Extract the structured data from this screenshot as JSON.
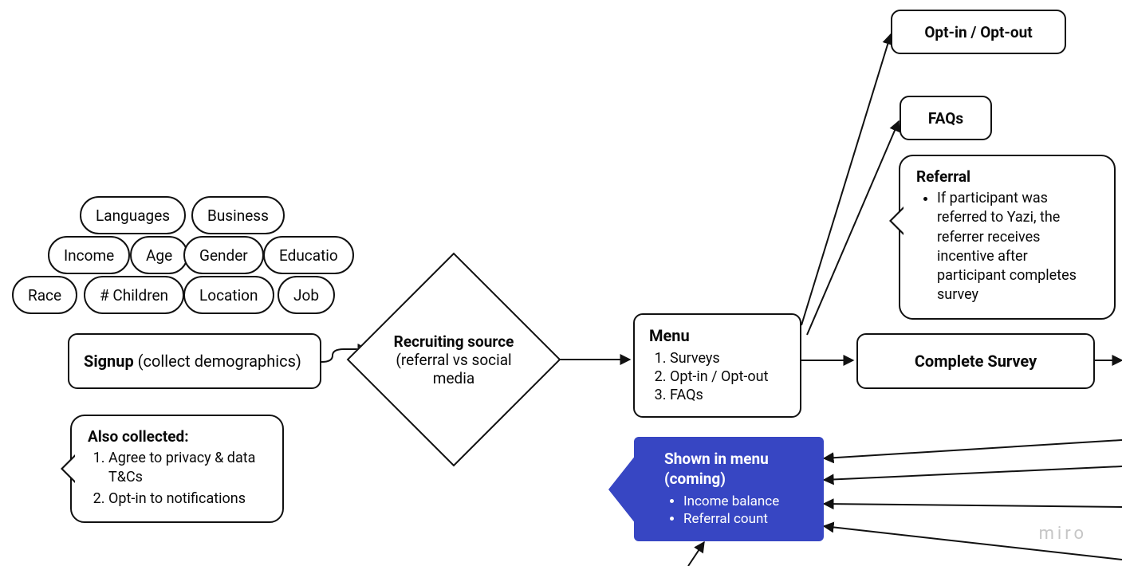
{
  "watermark": "miro",
  "tags": {
    "row1": [
      "Languages",
      "Business"
    ],
    "row2": [
      "Income",
      "Age",
      "Gender",
      "Educatio"
    ],
    "row3": [
      "Race",
      "# Children",
      "Location",
      "Job"
    ]
  },
  "signup": {
    "title": "Signup",
    "subtitle": " (collect demographics)"
  },
  "also_collected": {
    "title": "Also collected:",
    "items": [
      "Agree to privacy & data T&Cs",
      "Opt-in to notifications"
    ]
  },
  "recruiting": {
    "title": "Recruiting source",
    "subtitle": "(referral vs social media"
  },
  "menu": {
    "title": "Menu",
    "items": [
      "Surveys",
      "Opt-in / Opt-out",
      "FAQs"
    ]
  },
  "shown_in_menu": {
    "title_l1": "Shown in menu",
    "title_l2": "(coming)",
    "items": [
      "Income balance",
      "Referral count"
    ]
  },
  "opt_box": "Opt-in / Opt-out",
  "faqs_box": "FAQs",
  "referral": {
    "title": "Referral",
    "text": "If participant was referred to Yazi, the referrer receives incentive after participant completes survey"
  },
  "complete_survey": "Complete Survey",
  "colors": {
    "accent_blue": "#3746c3"
  }
}
